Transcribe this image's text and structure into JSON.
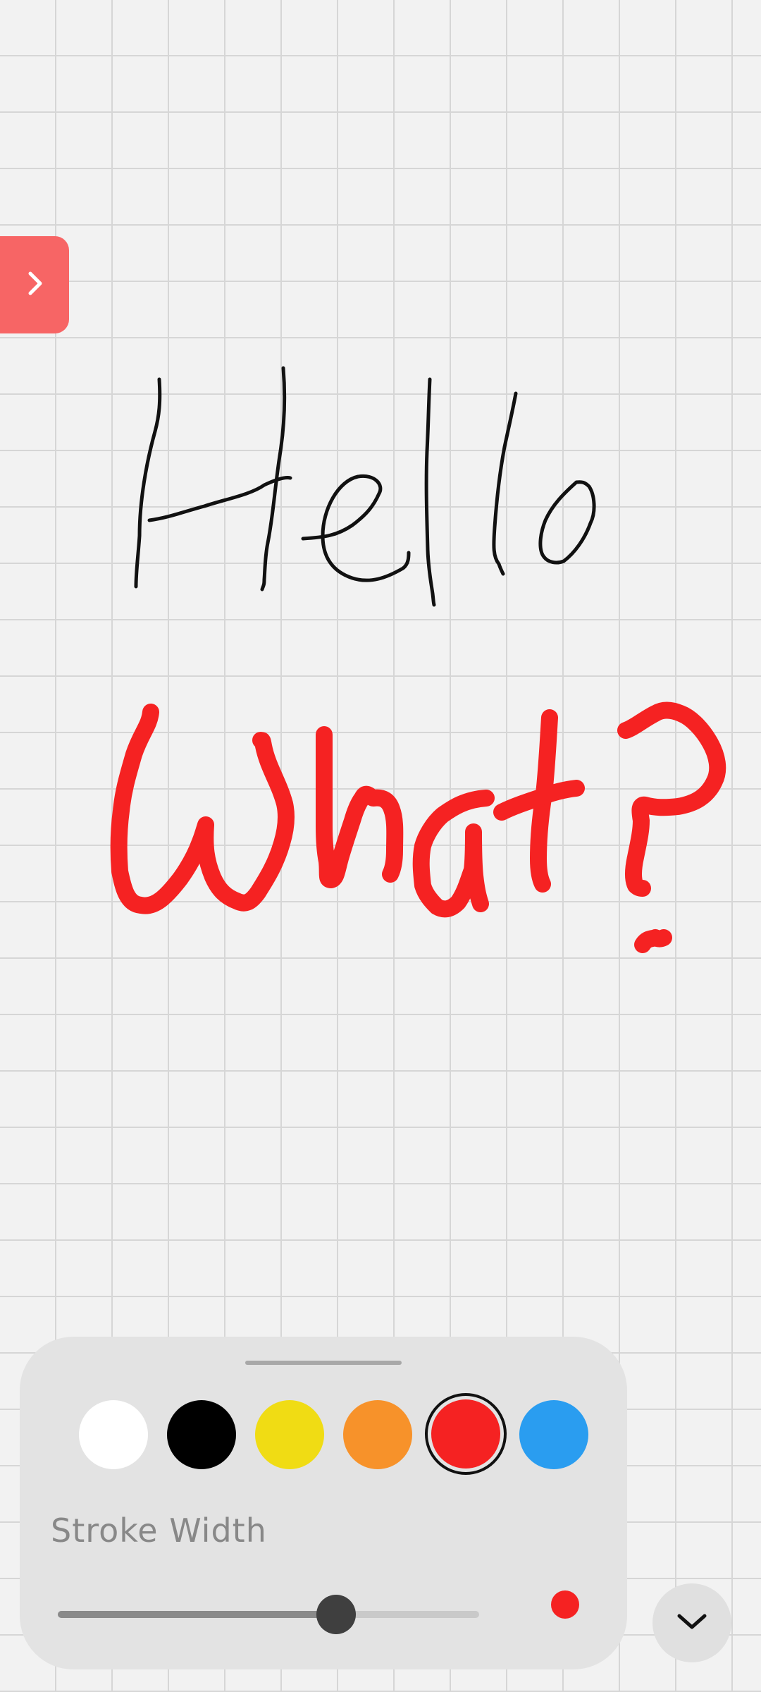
{
  "canvas": {
    "background": "#f2f2f2",
    "grid_color": "#d6d6d6"
  },
  "side_toggle": {
    "icon": "chevron-right-icon",
    "color": "#f76565"
  },
  "drawing": {
    "strokes": [
      {
        "name": "hello-strokes",
        "color": "#111111"
      },
      {
        "name": "what-strokes",
        "color": "#f52222"
      }
    ]
  },
  "toolbox": {
    "colors": [
      {
        "name": "white",
        "hex": "#ffffff",
        "selected": false
      },
      {
        "name": "black",
        "hex": "#000000",
        "selected": false
      },
      {
        "name": "yellow",
        "hex": "#f0dc14",
        "selected": false
      },
      {
        "name": "orange",
        "hex": "#f7922a",
        "selected": false
      },
      {
        "name": "red",
        "hex": "#f52222",
        "selected": true
      },
      {
        "name": "blue",
        "hex": "#2a9df0",
        "selected": false
      }
    ],
    "stroke_width_label": "Stroke Width",
    "stroke_width_fraction": 0.66,
    "stroke_preview_color": "#f52222"
  },
  "collapse_button": {
    "icon": "chevron-down-icon"
  }
}
